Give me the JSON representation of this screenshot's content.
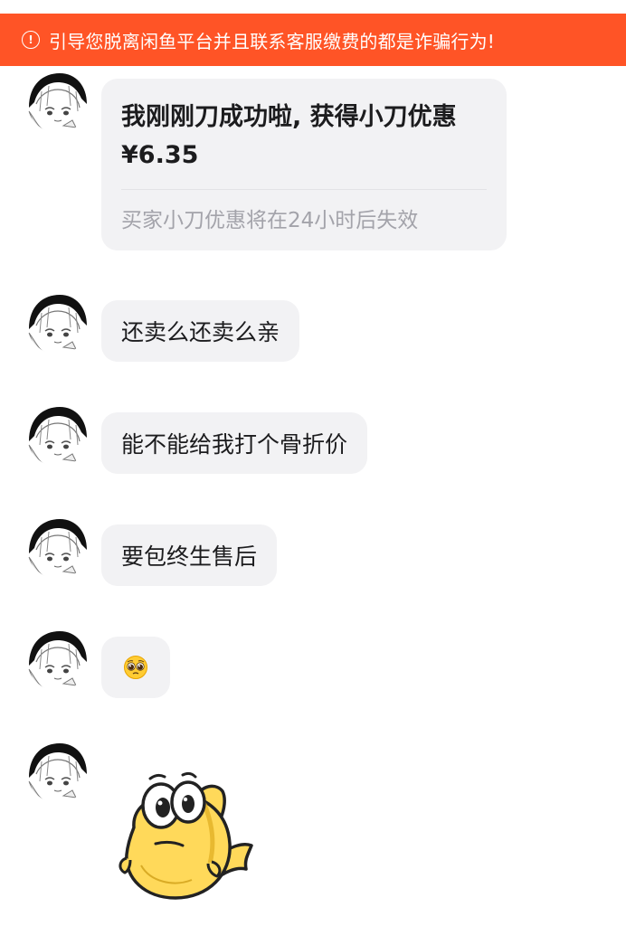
{
  "banner": {
    "icon": "exclamation-circle-icon",
    "text": "引导您脱离闲鱼平台并且联系客服缴费的都是诈骗行为!"
  },
  "card": {
    "title": "我刚刚刀成功啦, 获得小刀优惠",
    "amount": "¥6.35",
    "footer": "买家小刀优惠将在24小时后失效"
  },
  "messages": [
    {
      "text": "还卖么还卖么亲"
    },
    {
      "text": "能不能给我打个骨折价"
    },
    {
      "text": "要包终生售后"
    }
  ],
  "emoji_message": {
    "emoji": "pleading-face-emoji"
  },
  "sticker": {
    "name": "yellow-fish-sticker"
  }
}
